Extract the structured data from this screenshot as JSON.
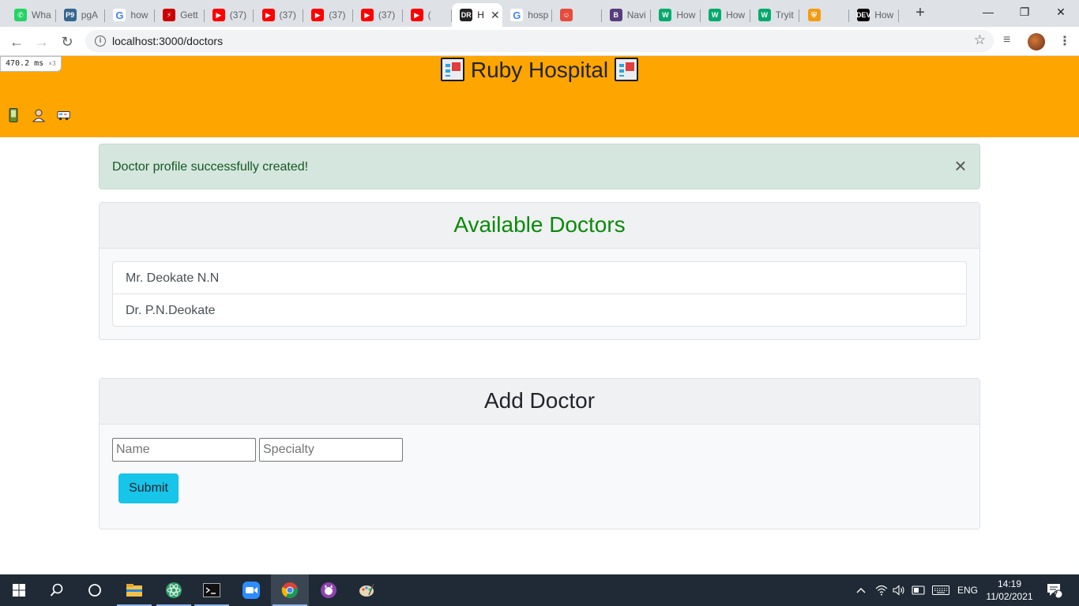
{
  "browser": {
    "tabs": [
      {
        "label": "Wha",
        "favicon": "whatsapp-icon",
        "color": "#25d366",
        "glyph": "✆"
      },
      {
        "label": "pgA",
        "favicon": "pgadmin-icon",
        "color": "#336791",
        "glyph": "P9"
      },
      {
        "label": "how",
        "favicon": "google-icon",
        "color": "#ffffff",
        "glyph": "G"
      },
      {
        "label": "Gett",
        "favicon": "rails-icon",
        "color": "#cc0000",
        "glyph": "⚡"
      },
      {
        "label": "(37)",
        "favicon": "youtube-icon",
        "color": "#ff0000",
        "glyph": "▶"
      },
      {
        "label": "(37)",
        "favicon": "youtube-icon",
        "color": "#ff0000",
        "glyph": "▶"
      },
      {
        "label": "(37)",
        "favicon": "youtube-icon",
        "color": "#ff0000",
        "glyph": "▶"
      },
      {
        "label": "(37)",
        "favicon": "youtube-icon",
        "color": "#ff0000",
        "glyph": "▶"
      },
      {
        "label": "(",
        "favicon": "youtube-icon",
        "color": "#ff0000",
        "glyph": "▶"
      },
      {
        "label": "H",
        "favicon": "ruby-hospital-icon",
        "color": "#222222",
        "glyph": "DR",
        "active": true
      },
      {
        "label": "hosp",
        "favicon": "google-icon",
        "color": "#ffffff",
        "glyph": "G"
      },
      {
        "label": "",
        "favicon": "extension-icon",
        "color": "#e74c3c",
        "glyph": "☺"
      },
      {
        "label": "Navi",
        "favicon": "bootstrap-icon",
        "color": "#563d7c",
        "glyph": "B"
      },
      {
        "label": "How",
        "favicon": "w3-icon",
        "color": "#04aa6d",
        "glyph": "W"
      },
      {
        "label": "How",
        "favicon": "w3-icon",
        "color": "#04aa6d",
        "glyph": "W"
      },
      {
        "label": "Tryit",
        "favicon": "w3-icon",
        "color": "#04aa6d",
        "glyph": "W"
      },
      {
        "label": "",
        "favicon": "hospital-tab-icon",
        "color": "#f39c12",
        "glyph": "⛨"
      },
      {
        "label": "How",
        "favicon": "dev-icon",
        "color": "#000000",
        "glyph": "DEV"
      }
    ],
    "new_tab": "+",
    "url": "localhost:3000/doctors",
    "window": {
      "minimize": "—",
      "maximize": "❐",
      "close": "✕"
    }
  },
  "devtools_timing": {
    "value": "470.2",
    "unit": "ms",
    "multiplier": "×3"
  },
  "header": {
    "title": "Ruby Hospital"
  },
  "nav_icons": [
    "phone-icon",
    "doctor-icon",
    "ambulance-icon"
  ],
  "alert": {
    "message": "Doctor profile successfully created!",
    "close": "×"
  },
  "doctors_card": {
    "title": "Available Doctors",
    "doctors": [
      "Mr. Deokate N.N",
      "Dr. P.N.Deokate"
    ]
  },
  "add_card": {
    "title": "Add Doctor",
    "name_placeholder": "Name",
    "specialty_placeholder": "Specialty",
    "submit": "Submit"
  },
  "taskbar": {
    "language": "ENG",
    "time": "14:19",
    "date": "11/02/2021",
    "notifications": "7"
  },
  "colors": {
    "header_bg": "#ffa500",
    "heading_green": "#0a8a0a",
    "alert_bg": "#d4e6dd",
    "submit_bg": "#17c5ea"
  }
}
